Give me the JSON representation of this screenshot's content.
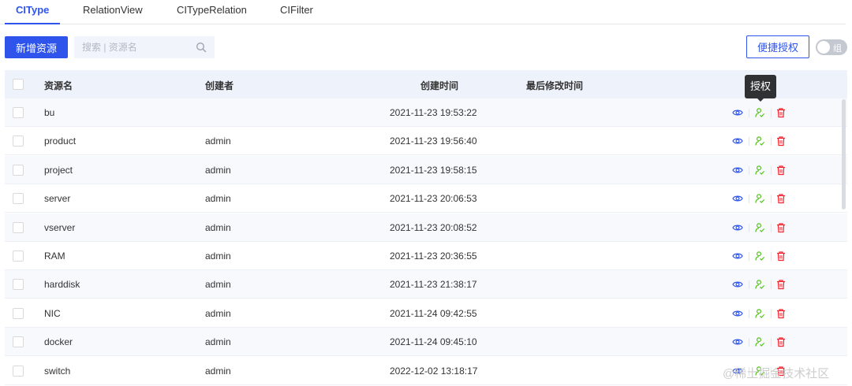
{
  "tabs": [
    {
      "label": "CIType"
    },
    {
      "label": "RelationView"
    },
    {
      "label": "CITypeRelation"
    },
    {
      "label": "CIFilter"
    }
  ],
  "toolbar": {
    "add_label": "新增资源",
    "search_placeholder": "搜索 | 资源名",
    "quick_grant_label": "便捷授权",
    "toggle_label": "组"
  },
  "table": {
    "columns": [
      "资源名",
      "创建者",
      "创建时间",
      "最后修改时间"
    ],
    "rows": [
      {
        "name": "bu",
        "creator": "",
        "created": "2021-11-23 19:53:22"
      },
      {
        "name": "product",
        "creator": "admin",
        "created": "2021-11-23 19:56:40"
      },
      {
        "name": "project",
        "creator": "admin",
        "created": "2021-11-23 19:58:15"
      },
      {
        "name": "server",
        "creator": "admin",
        "created": "2021-11-23 20:06:53"
      },
      {
        "name": "vserver",
        "creator": "admin",
        "created": "2021-11-23 20:08:52"
      },
      {
        "name": "RAM",
        "creator": "admin",
        "created": "2021-11-23 20:36:55"
      },
      {
        "name": "harddisk",
        "creator": "admin",
        "created": "2021-11-23 21:38:17"
      },
      {
        "name": "NIC",
        "creator": "admin",
        "created": "2021-11-24 09:42:55"
      },
      {
        "name": "docker",
        "creator": "admin",
        "created": "2021-11-24 09:45:10"
      },
      {
        "name": "switch",
        "creator": "admin",
        "created": "2022-12-02 13:18:17"
      }
    ]
  },
  "tooltip": {
    "text": "授权"
  },
  "watermark": {
    "text": "@稀土掘金技术社区"
  },
  "colors": {
    "primary": "#2f54eb",
    "view_icon": "#2f54eb",
    "grant_icon": "#52c41a",
    "delete_icon": "#f5222d"
  },
  "icons": {
    "view": "eye-icon",
    "grant": "user-grant-icon",
    "delete": "trash-icon",
    "search": "search-icon"
  }
}
